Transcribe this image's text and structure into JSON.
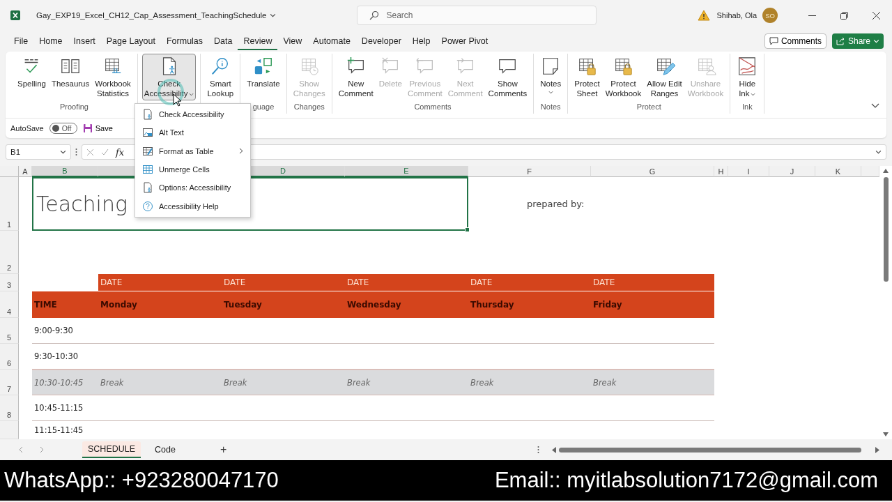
{
  "title_bar": {
    "document_title": "Gay_EXP19_Excel_CH12_Cap_Assessment_TeachingSchedule",
    "search": {
      "placeholder": "Search"
    },
    "user": {
      "name": "Shihab, Ola",
      "initials": "SO"
    }
  },
  "menu_tabs": [
    {
      "label": "File",
      "selected": false
    },
    {
      "label": "Home",
      "selected": false
    },
    {
      "label": "Insert",
      "selected": false
    },
    {
      "label": "Page Layout",
      "selected": false
    },
    {
      "label": "Formulas",
      "selected": false
    },
    {
      "label": "Data",
      "selected": false
    },
    {
      "label": "Review",
      "selected": true
    },
    {
      "label": "View",
      "selected": false
    },
    {
      "label": "Automate",
      "selected": false
    },
    {
      "label": "Developer",
      "selected": false
    },
    {
      "label": "Help",
      "selected": false
    },
    {
      "label": "Power Pivot",
      "selected": false
    }
  ],
  "comments_button": "Comments",
  "share_button": "Share",
  "ribbon": {
    "groups": [
      {
        "label": "Proofing",
        "buttons": [
          {
            "label": "Spelling",
            "kind": "spelling",
            "disabled": false,
            "pressed": false,
            "dropdown": false
          },
          {
            "label": "Thesaurus",
            "kind": "thesaurus",
            "disabled": false,
            "pressed": false,
            "dropdown": false
          },
          {
            "label": "Workbook\nStatistics",
            "kind": "stats",
            "disabled": false,
            "pressed": false,
            "dropdown": false
          }
        ]
      },
      {
        "buttons": [
          {
            "label": "Check\nAccessibility",
            "kind": "accessibility",
            "disabled": false,
            "pressed": true,
            "dropdown": true
          }
        ]
      },
      {
        "buttons": [
          {
            "label": "Smart\nLookup",
            "kind": "lookup",
            "disabled": false,
            "pressed": false,
            "dropdown": false
          }
        ]
      },
      {
        "label": "guage",
        "buttons": [
          {
            "label": "Translate",
            "kind": "translate",
            "disabled": false,
            "pressed": false,
            "dropdown": false
          }
        ]
      },
      {
        "label": "Changes",
        "buttons": [
          {
            "label": "Show\nChanges",
            "kind": "changes",
            "disabled": true,
            "pressed": false,
            "dropdown": false
          }
        ]
      },
      {
        "label": "Comments",
        "buttons": [
          {
            "label": "New\nComment",
            "kind": "new-comment",
            "disabled": false,
            "pressed": false,
            "dropdown": false
          },
          {
            "label": "Delete",
            "kind": "delete-comment",
            "disabled": true,
            "pressed": false,
            "dropdown": false
          },
          {
            "label": "Previous\nComment",
            "kind": "prev-comment",
            "disabled": true,
            "pressed": false,
            "dropdown": false
          },
          {
            "label": "Next\nComment",
            "kind": "next-comment",
            "disabled": true,
            "pressed": false,
            "dropdown": false
          },
          {
            "label": "Show\nComments",
            "kind": "show-comments",
            "disabled": false,
            "pressed": false,
            "dropdown": false
          }
        ]
      },
      {
        "label": "Notes",
        "buttons": [
          {
            "label": "Notes",
            "kind": "notes",
            "disabled": false,
            "pressed": false,
            "dropdown": true
          }
        ]
      },
      {
        "label": "Protect",
        "buttons": [
          {
            "label": "Protect\nSheet",
            "kind": "protect",
            "disabled": false,
            "pressed": false,
            "dropdown": false
          },
          {
            "label": "Protect\nWorkbook",
            "kind": "protect",
            "disabled": false,
            "pressed": false,
            "dropdown": false
          },
          {
            "label": "Allow Edit\nRanges",
            "kind": "allow-edit",
            "disabled": false,
            "pressed": false,
            "dropdown": false
          },
          {
            "label": "Unshare\nWorkbook",
            "kind": "unshare",
            "disabled": true,
            "pressed": false,
            "dropdown": false
          }
        ]
      },
      {
        "label": "Ink",
        "buttons": [
          {
            "label": "Hide\nInk",
            "kind": "ink",
            "disabled": false,
            "pressed": false,
            "dropdown": true
          }
        ]
      }
    ]
  },
  "quick_access": {
    "autosave_label": "AutoSave",
    "autosave_on": false,
    "autosave_state": "Off",
    "save": "Save"
  },
  "formula_bar": {
    "name_box": "B1",
    "function_label": "fx"
  },
  "dropdown_menu": [
    {
      "label": "Check Accessibility",
      "kind": "accessibility",
      "submenu": false
    },
    {
      "label": "Alt Text",
      "kind": "alt-text",
      "submenu": false
    },
    {
      "label": "Format as Table",
      "kind": "format-table",
      "submenu": true
    },
    {
      "label": "Unmerge Cells",
      "kind": "unmerge",
      "submenu": false
    },
    {
      "label": "Options: Accessibility",
      "kind": "options",
      "submenu": false
    },
    {
      "label": "Accessibility Help",
      "kind": "help",
      "submenu": false
    }
  ],
  "column_headers": [
    {
      "label": "A",
      "selected": false
    },
    {
      "label": "B",
      "selected": true
    },
    {
      "selected": true
    },
    {
      "label": "D",
      "selected": true
    },
    {
      "label": "E",
      "selected": true
    },
    {
      "label": "F",
      "selected": false
    },
    {
      "label": "G",
      "selected": false
    },
    {
      "label": "H",
      "selected": false
    },
    {
      "label": "I",
      "selected": false
    },
    {
      "label": "J",
      "selected": false
    },
    {
      "label": "K",
      "selected": false
    }
  ],
  "row_numbers": [
    "1",
    "2",
    "3",
    "4",
    "5",
    "6",
    "7",
    "8"
  ],
  "sheet_title": "Teaching",
  "prepared_by": "prepared by:",
  "schedule": {
    "date_row": [
      "DATE",
      "DATE",
      "DATE",
      "DATE",
      "DATE"
    ],
    "header_row": [
      "TIME",
      "Monday",
      "Tuesday",
      "Wednesday",
      "Thursday",
      "Friday"
    ],
    "rows": [
      {
        "kind": "slot",
        "cells": [
          "9:00-9:30"
        ]
      },
      {
        "kind": "slot",
        "cells": [
          "9:30-10:30"
        ]
      },
      {
        "kind": "break",
        "cells": [
          "10:30-10:45",
          "Break",
          "Break",
          "Break",
          "Break",
          "Break"
        ]
      },
      {
        "kind": "slot",
        "cells": [
          "10:45-11:15"
        ]
      },
      {
        "kind": "slot",
        "cells": [
          "11:15-11:45"
        ]
      }
    ]
  },
  "sheet_tabs": [
    {
      "label": "SCHEDULE",
      "selected": true
    },
    {
      "label": "Code",
      "selected": false
    }
  ],
  "add_sheet": "+",
  "banner": {
    "whatsapp": "WhatsApp:: +923280047170",
    "email": "Email:: myitlabsolution7172@gmail.com"
  }
}
